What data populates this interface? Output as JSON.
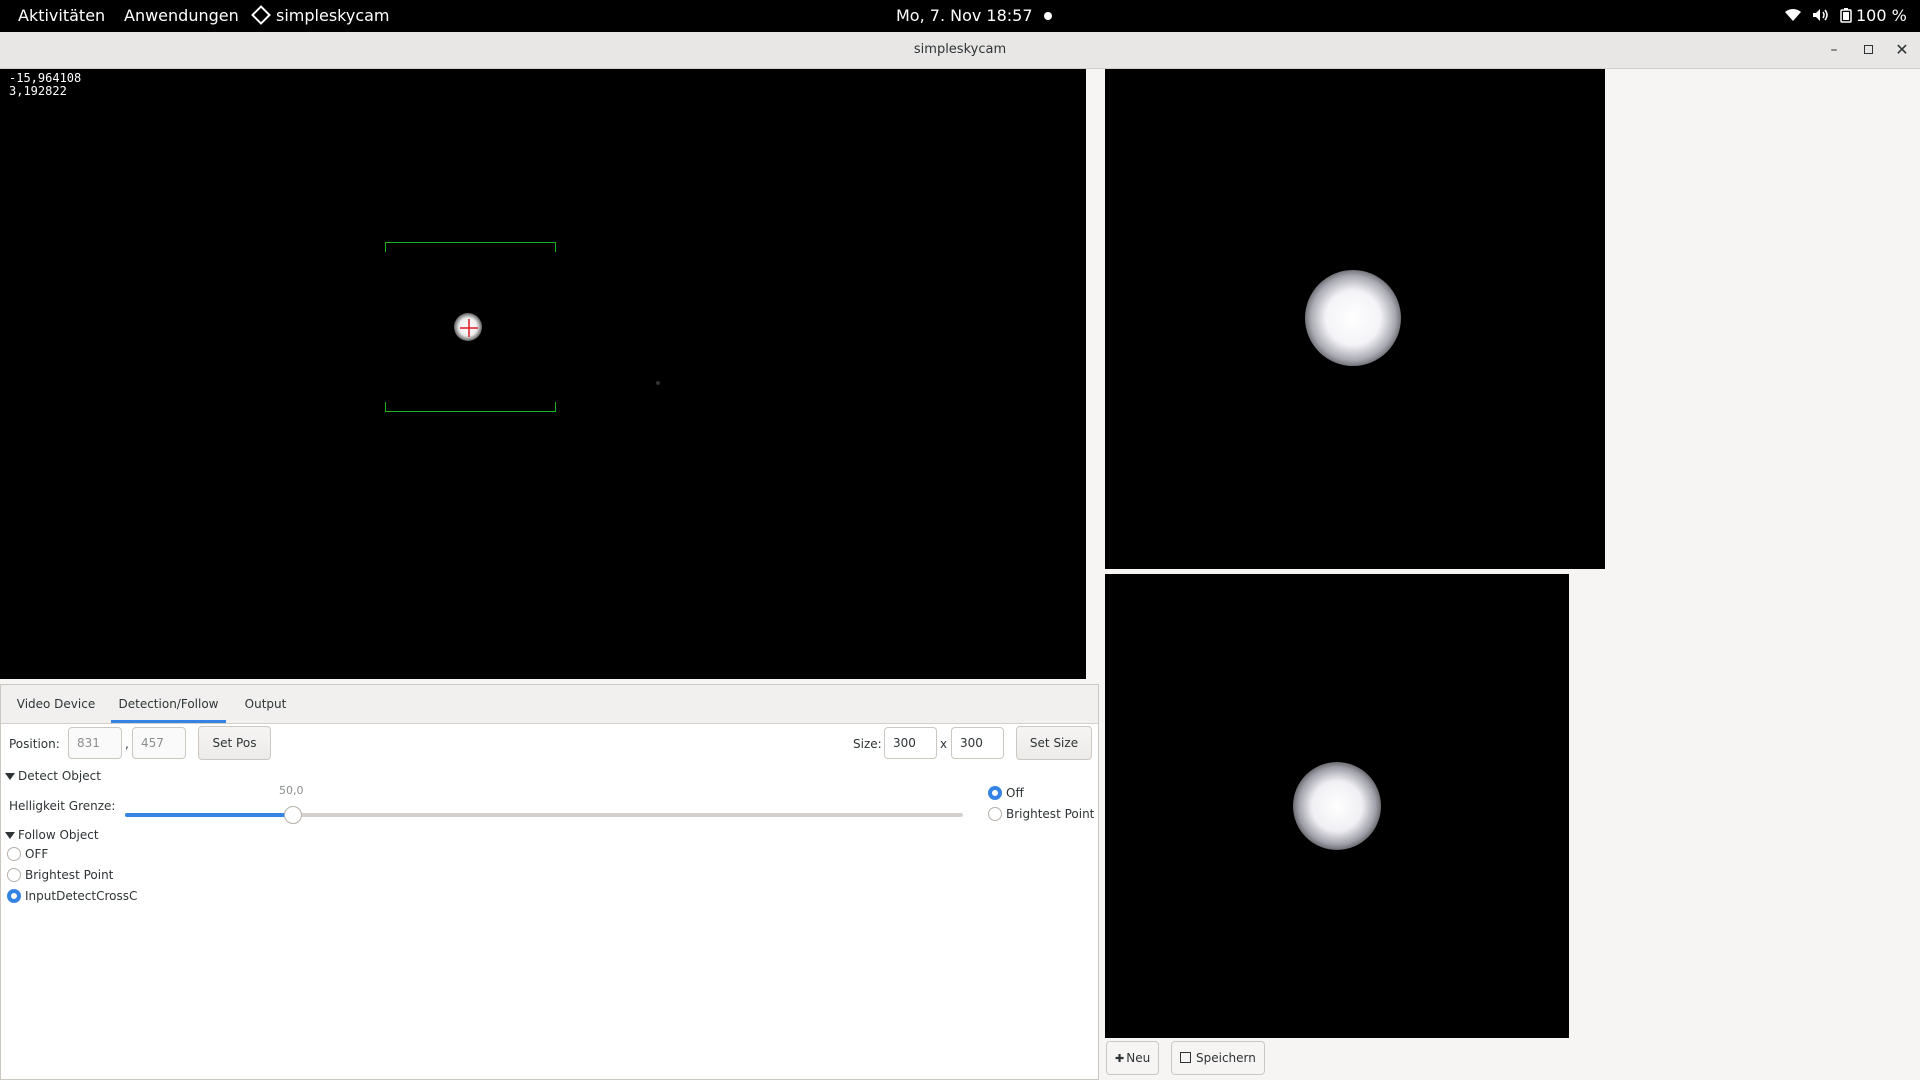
{
  "topbar": {
    "activities": "Aktivitäten",
    "applications": "Anwendungen",
    "app_name": "simpleskycam",
    "clock": "Mo,  7. Nov  18:57",
    "battery": "100 %"
  },
  "window": {
    "title": "simpleskycam"
  },
  "mainview": {
    "coord_x": "-15,964108",
    "coord_y": "3,192822"
  },
  "tabs": [
    {
      "label": "Video Device"
    },
    {
      "label": "Detection/Follow"
    },
    {
      "label": "Output"
    }
  ],
  "detection": {
    "position_label": "Position:",
    "position_x": "831",
    "position_y": "457",
    "comma": ",",
    "set_pos_label": "Set Pos",
    "size_label": "Size:",
    "size_w": "300",
    "size_x": "x",
    "size_h": "300",
    "set_size_label": "Set Size",
    "detect_object_label": "Detect Object",
    "brightness_label": "Helligkeit Grenze:",
    "brightness_value": "50,0",
    "brightness_fraction": 0.2,
    "detect_options": [
      {
        "label": "Off",
        "selected": true
      },
      {
        "label": "Brightest Point",
        "selected": false
      }
    ],
    "follow_object_label": "Follow Object",
    "follow_options": [
      {
        "label": "OFF",
        "selected": false
      },
      {
        "label": "Brightest Point",
        "selected": false
      },
      {
        "label": "InputDetectCrossC",
        "selected": true
      }
    ]
  },
  "footer": {
    "new_label": "Neu",
    "save_label": "Speichern"
  },
  "colors": {
    "accent": "#3584e4",
    "box": "#1db31d",
    "cross": "#e01b24"
  }
}
